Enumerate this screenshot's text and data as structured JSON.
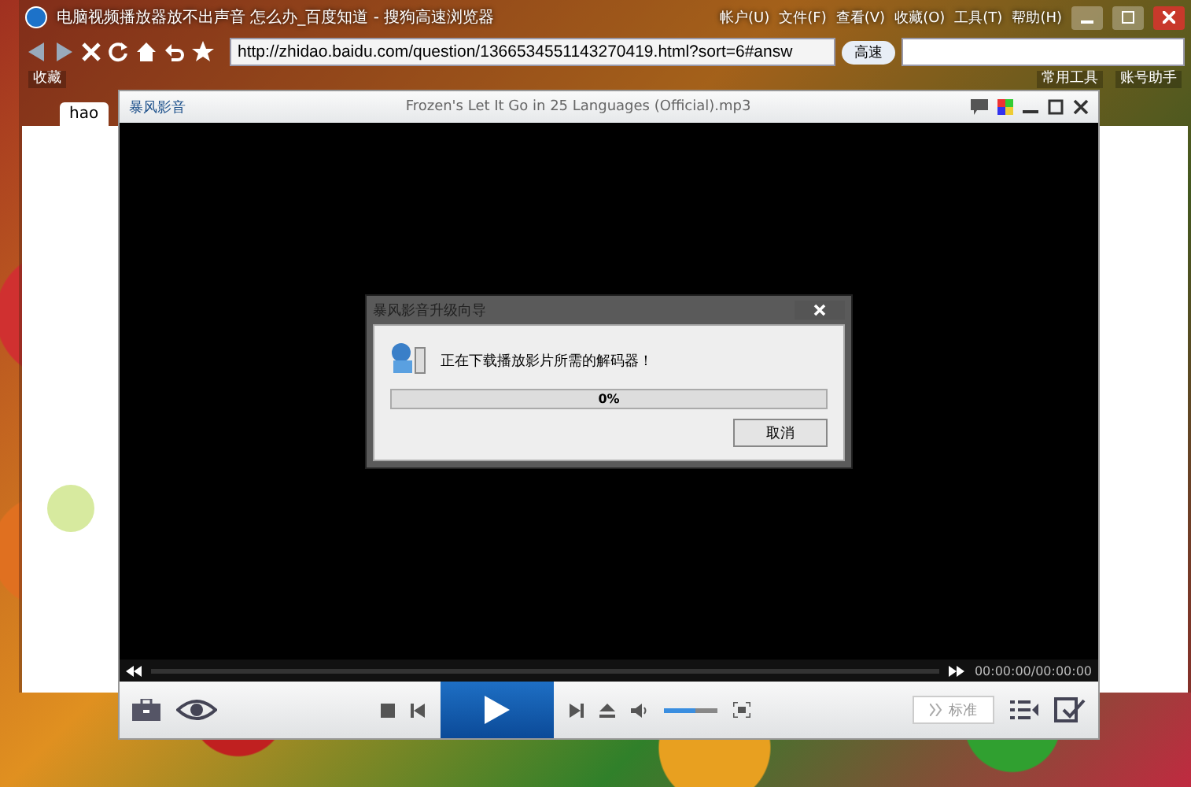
{
  "browser": {
    "title": "电脑视频播放器放不出声音 怎么办_百度知道 - 搜狗高速浏览器",
    "menu": [
      "帐户(U)",
      "文件(F)",
      "查看(V)",
      "收藏(O)",
      "工具(T)",
      "帮助(H)"
    ],
    "address": "http://zhidao.baidu.com/question/1366534551143270419.html?sort=6#answ",
    "speed_button": "高速",
    "bookmarks": [
      {
        "label": "收藏"
      },
      {
        "label": "常用工具"
      },
      {
        "label": "账号助手"
      }
    ],
    "tabs": [
      {
        "label": "hao",
        "selected": true
      }
    ]
  },
  "player": {
    "app_name": "暴风影音",
    "title": "Frozen's Let It Go in 25 Languages (Official).mp3",
    "time": "00:00:00/00:00:00",
    "seek": {
      "level": 0
    },
    "volume": {
      "level": 0.6
    },
    "quality_button": "标准"
  },
  "dialog": {
    "title": "暴风影音升级向导",
    "message": "正在下载播放影片所需的解码器！",
    "progress": {
      "level": 0,
      "label": "0%"
    },
    "cancel_button": "取消"
  }
}
